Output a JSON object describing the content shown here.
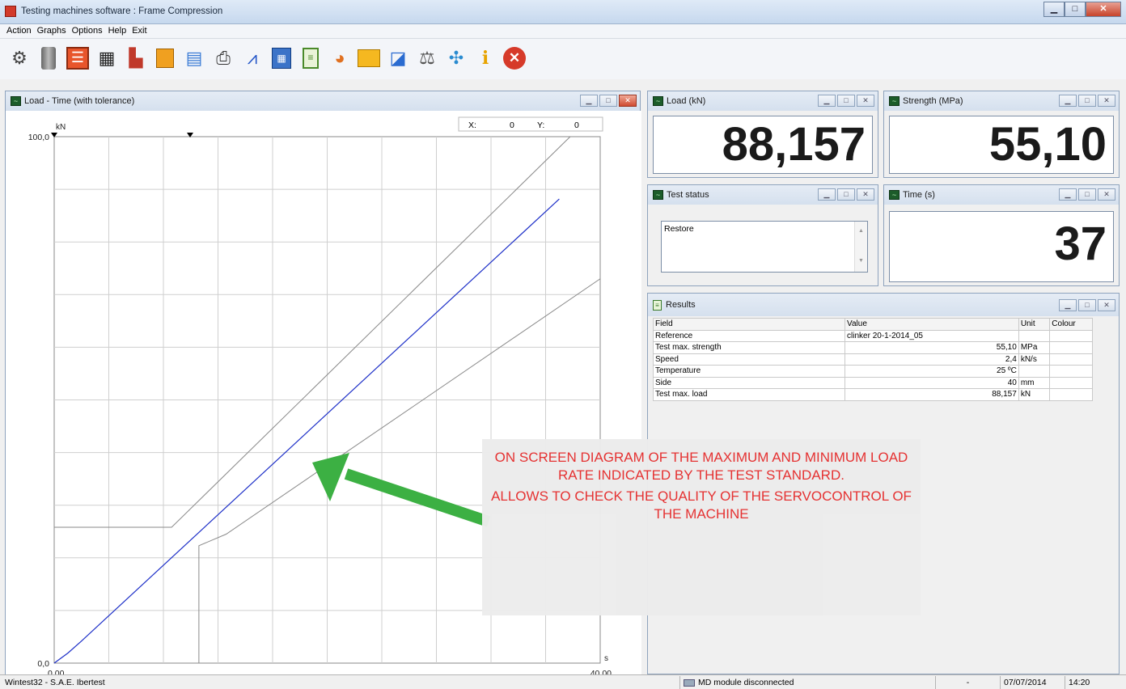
{
  "window": {
    "title": "Testing machines software : Frame Compression"
  },
  "menu": [
    "Action",
    "Graphs",
    "Options",
    "Help",
    "Exit"
  ],
  "toolbar_icons": [
    "settings-gear-icon",
    "cylinder-icon",
    "sliders-icon",
    "monitor-icon",
    "actuator-icon",
    "specimen-icon",
    "report-icon",
    "printer-icon",
    "graph-peaks-icon",
    "calculator-icon",
    "list-icon",
    "color-palette-icon",
    "folder-icon",
    "screen-edit-icon",
    "calibrate-icon",
    "fullscreen-icon",
    "info-icon",
    "close-red-icon"
  ],
  "graph_panel": {
    "title": "Load - Time (with tolerance)",
    "coord_x_label": "X:",
    "coord_x": "0",
    "coord_y_label": "Y:",
    "coord_y": "0"
  },
  "chart_data": {
    "type": "line",
    "y_unit": "kN",
    "x_unit": "s",
    "xlim": [
      0,
      40
    ],
    "ylim": [
      0,
      100
    ],
    "x_tick_labels": [
      "0,00",
      "40,00"
    ],
    "y_tick_labels": [
      "0,0",
      "100,0"
    ],
    "grid": true,
    "series": [
      {
        "x": [
          0,
          1,
          2,
          37
        ],
        "y": [
          0,
          1.9,
          4.2,
          88.16
        ]
      },
      {
        "x": [
          0,
          8.6,
          37.8
        ],
        "y": [
          25.8,
          25.8,
          100
        ]
      },
      {
        "x": [
          10.6,
          10.6,
          12.6,
          40
        ],
        "y": [
          0,
          22.3,
          24.5,
          73
        ]
      }
    ]
  },
  "load_panel": {
    "title": "Load (kN)",
    "value": "88,157"
  },
  "strength_panel": {
    "title": "Strength (MPa)",
    "value": "55,10"
  },
  "status_panel": {
    "title": "Test status",
    "text": "Restore"
  },
  "time_panel": {
    "title": "Time (s)",
    "value": "37"
  },
  "results_panel": {
    "title": "Results",
    "headers": [
      "Field",
      "Value",
      "Unit",
      "Colour"
    ],
    "rows": [
      {
        "field": "Reference",
        "value": "clinker 20-1-2014_05",
        "unit": ""
      },
      {
        "field": "Test max. strength",
        "value": "55,10",
        "unit": "MPa"
      },
      {
        "field": "Speed",
        "value": "2,4",
        "unit": "kN/s"
      },
      {
        "field": "Temperature",
        "value": "25 ºC",
        "unit": ""
      },
      {
        "field": "Side",
        "value": "40",
        "unit": "mm"
      },
      {
        "field": "Test max. load",
        "value": "88,157",
        "unit": "kN"
      }
    ]
  },
  "annotation": {
    "line1": "ON SCREEN DIAGRAM OF THE MAXIMUM AND MINIMUM LOAD RATE INDICATED BY THE TEST STANDARD.",
    "line2": "ALLOWS TO CHECK THE QUALITY OF THE SERVOCONTROL OF THE MACHINE",
    "arrow_color": "#3cb043",
    "text_color": "#e52c2c"
  },
  "statusbar": {
    "left": "Wintest32 - S.A.E. Ibertest",
    "module": "MD module disconnected",
    "dash": "-",
    "date": "07/07/2014",
    "time": "14:20"
  }
}
